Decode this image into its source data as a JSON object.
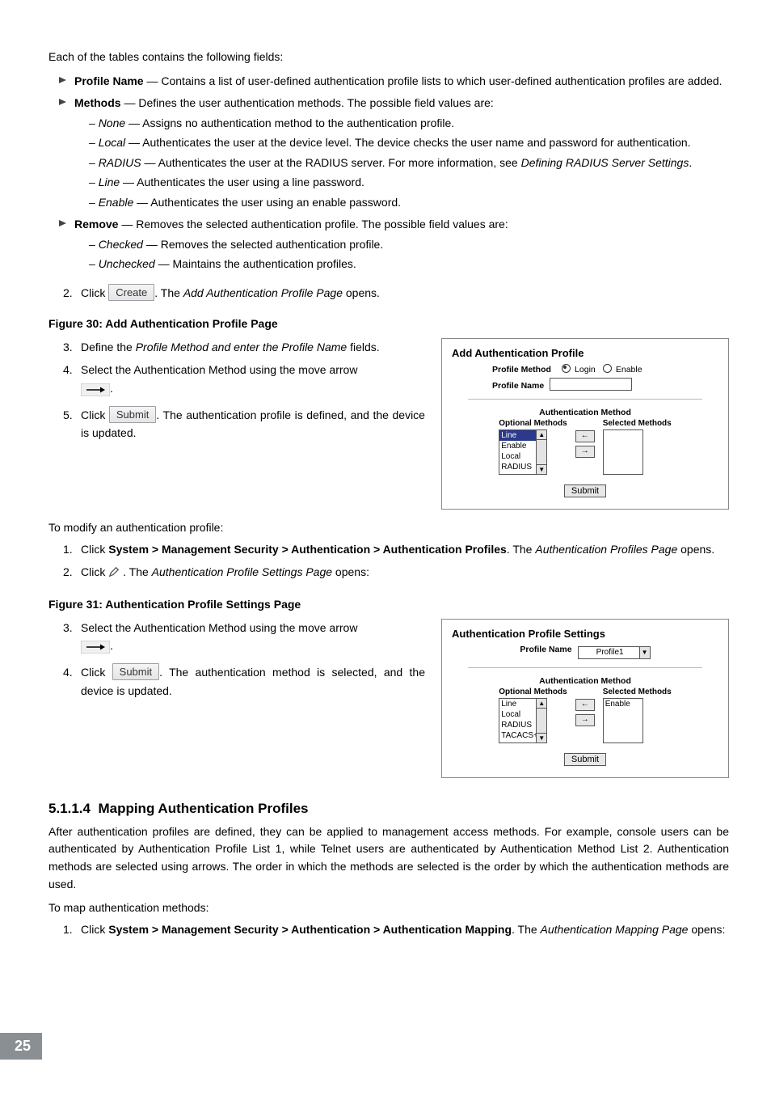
{
  "intro": "Each of the tables contains the following fields:",
  "bullets": {
    "profile_name": {
      "lead_label": "Profile Name",
      "lead_text": " — Contains a list of user-defined authentication profile lists to which user-defined authentication profiles are added."
    },
    "methods": {
      "lead_label": "Methods",
      "lead_text": " — Defines the user authentication methods. The possible field values are:",
      "subs": [
        {
          "name": "None",
          "text": " — Assigns no authentication method to the authentication profile."
        },
        {
          "name": "Local",
          "text": " — Authenticates the user at the device level. The device checks the user name and password for authentication."
        },
        {
          "name": "RADIUS",
          "text": " — Authenticates the user at the RADIUS server. For more information, see ",
          "tail_italic": "Defining RADIUS Server Settings",
          "tail_plain": "."
        },
        {
          "name": "Line",
          "text": " — Authenticates the user using a line password."
        },
        {
          "name": "Enable",
          "text": " — Authenticates the user using an enable password."
        }
      ]
    },
    "remove": {
      "lead_label": "Remove",
      "lead_text": " — Removes the selected authentication profile. The possible field values are:",
      "subs": [
        {
          "name": "Checked",
          "text": " — Removes the selected authentication profile."
        },
        {
          "name": "Unchecked",
          "text": " — Maintains the authentication profiles."
        }
      ]
    }
  },
  "step2": {
    "num": "2.",
    "pre": "Click ",
    "btn": "Create",
    "post_plain": ". The ",
    "post_italic": "Add Authentication Profile Page",
    "post_tail": " opens."
  },
  "fig30_caption": "Figure 30: Add Authentication Profile Page",
  "dialog30": {
    "title": "Add Authentication Profile",
    "profile_method_label": "Profile Method",
    "radio_login": "Login",
    "radio_enable": "Enable",
    "profile_name_label": "Profile Name",
    "auth_method_title": "Authentication Method",
    "optional_label": "Optional Methods",
    "selected_label": "Selected Methods",
    "optional_items": [
      "Line",
      "Enable",
      "Local",
      "RADIUS"
    ],
    "selected_items": [],
    "submit": "Submit"
  },
  "left_steps_a": {
    "s3": {
      "num": "3.",
      "pre": "Define the ",
      "it": "Profile Method and enter the Profile Name",
      "post": " fields."
    },
    "s4": {
      "num": "4.",
      "pre": "Select the Authentication Method using the move arrow ",
      "post": "."
    },
    "s5": {
      "num": "5.",
      "pre": "Click ",
      "btn": "Submit",
      "post": ". The authentication profile is defined, and the device is updated."
    }
  },
  "modify_intro": "To modify an authentication profile:",
  "modify_steps": {
    "s1": {
      "num": "1.",
      "pre": "Click ",
      "bold": "System > Management Security > Authentication > Authentication Profiles",
      "mid": ". The ",
      "it": "Authentication Profiles Page",
      "post": " opens."
    },
    "s2": {
      "num": "2.",
      "pre": "Click ",
      "post_pre": " . The ",
      "it": "Authentication Profile Settings Page",
      "post": " opens:"
    }
  },
  "fig31_caption": "Figure 31: Authentication Profile Settings Page",
  "dialog31": {
    "title": "Authentication Profile Settings",
    "profile_name_label": "Profile Name",
    "profile_name_value": "Profile1",
    "auth_method_title": "Authentication Method",
    "optional_label": "Optional Methods",
    "selected_label": "Selected Methods",
    "optional_items": [
      "Line",
      "Local",
      "RADIUS",
      "TACACS+"
    ],
    "selected_items": [
      "Enable"
    ],
    "submit": "Submit"
  },
  "left_steps_b": {
    "s3": {
      "num": "3.",
      "pre": "Select the Authentication Method using the move arrow ",
      "post": "."
    },
    "s4": {
      "num": "4.",
      "pre": "Click ",
      "btn": "Submit",
      "post": ". The authentication method is selected, and the device is updated."
    }
  },
  "section": {
    "num": "5.1.1.4",
    "title": "Mapping Authentication Profiles",
    "para": "After authentication profiles are defined, they can be applied to management access methods. For example, console users can be authenticated by Authentication Profile List 1, while Telnet users are authenticated by Authentication Method List 2. Authentication methods are selected using arrows. The order in which the methods are selected is the order by which the authentication methods are used.",
    "lead": "To map authentication methods:",
    "s1": {
      "num": "1.",
      "pre": "Click ",
      "bold": "System > Management Security > Authentication > Authentication Mapping",
      "mid": ". The ",
      "it": "Authentication Mapping Page",
      "post": " opens:"
    }
  },
  "page_num": "25"
}
